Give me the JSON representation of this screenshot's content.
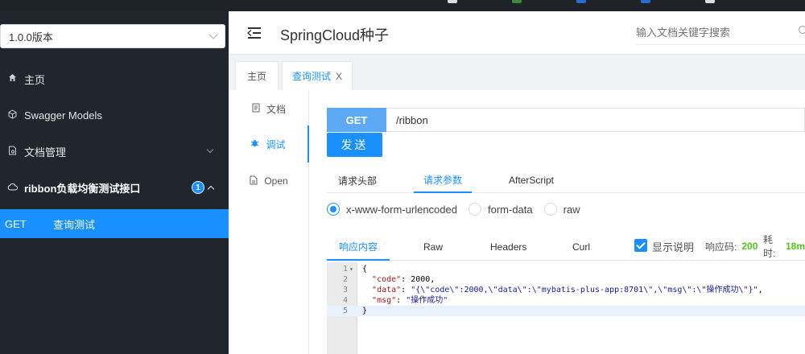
{
  "colors": {
    "accent": "#1890ff",
    "sidebar_bg": "#20262c",
    "method_badge": "#5ea9f5",
    "success": "#52c41a"
  },
  "sidebar": {
    "version_select": "1.0.0版本",
    "items": [
      {
        "label": "主页",
        "icon": "home-icon"
      },
      {
        "label": "Swagger Models",
        "icon": "cube-icon"
      },
      {
        "label": "文档管理",
        "icon": "doc-manage-icon"
      },
      {
        "label": "ribbon负载均衡测试接口",
        "icon": "cloud-icon",
        "badge": "1"
      }
    ],
    "active": {
      "method": "GET",
      "label": "查询测试"
    }
  },
  "header": {
    "title": "SpringCloud种子",
    "search_placeholder": "输入文档关键字搜索"
  },
  "tabs": [
    {
      "label": "主页"
    },
    {
      "label": "查询测试",
      "close": "X"
    }
  ],
  "vtabs": [
    {
      "label": "文档",
      "icon": "document-icon"
    },
    {
      "label": "调试",
      "icon": "bug-icon"
    },
    {
      "label": "Open",
      "icon": "file-icon"
    }
  ],
  "request": {
    "method": "GET",
    "url": "/ribbon",
    "send_label": "发送"
  },
  "sub_tabs": [
    "请求头部",
    "请求参数",
    "AfterScript"
  ],
  "radios": [
    "x-www-form-urlencoded",
    "form-data",
    "raw"
  ],
  "response": {
    "tabs": [
      "响应内容",
      "Raw",
      "Headers",
      "Curl"
    ],
    "show_desc": "显示说明",
    "code_label": "响应码:",
    "code_value": "200",
    "time_label": "耗时:",
    "time_value": "18m"
  },
  "code_lines": [
    {
      "n": "1",
      "text": "{"
    },
    {
      "n": "2",
      "key": "\"code\"",
      "rest": ": 2000,"
    },
    {
      "n": "3",
      "key": "\"data\"",
      "rest": ": ",
      "str": "\"{\\\"code\\\":2000,\\\"data\\\":\\\"mybatis-plus-app:8701\\\",\\\"msg\\\":\\\"操作成功\\\"}\"",
      "tail": ","
    },
    {
      "n": "4",
      "key": "\"msg\"",
      "rest": ": ",
      "str": "\"操作成功\""
    },
    {
      "n": "5",
      "text": "}"
    }
  ]
}
